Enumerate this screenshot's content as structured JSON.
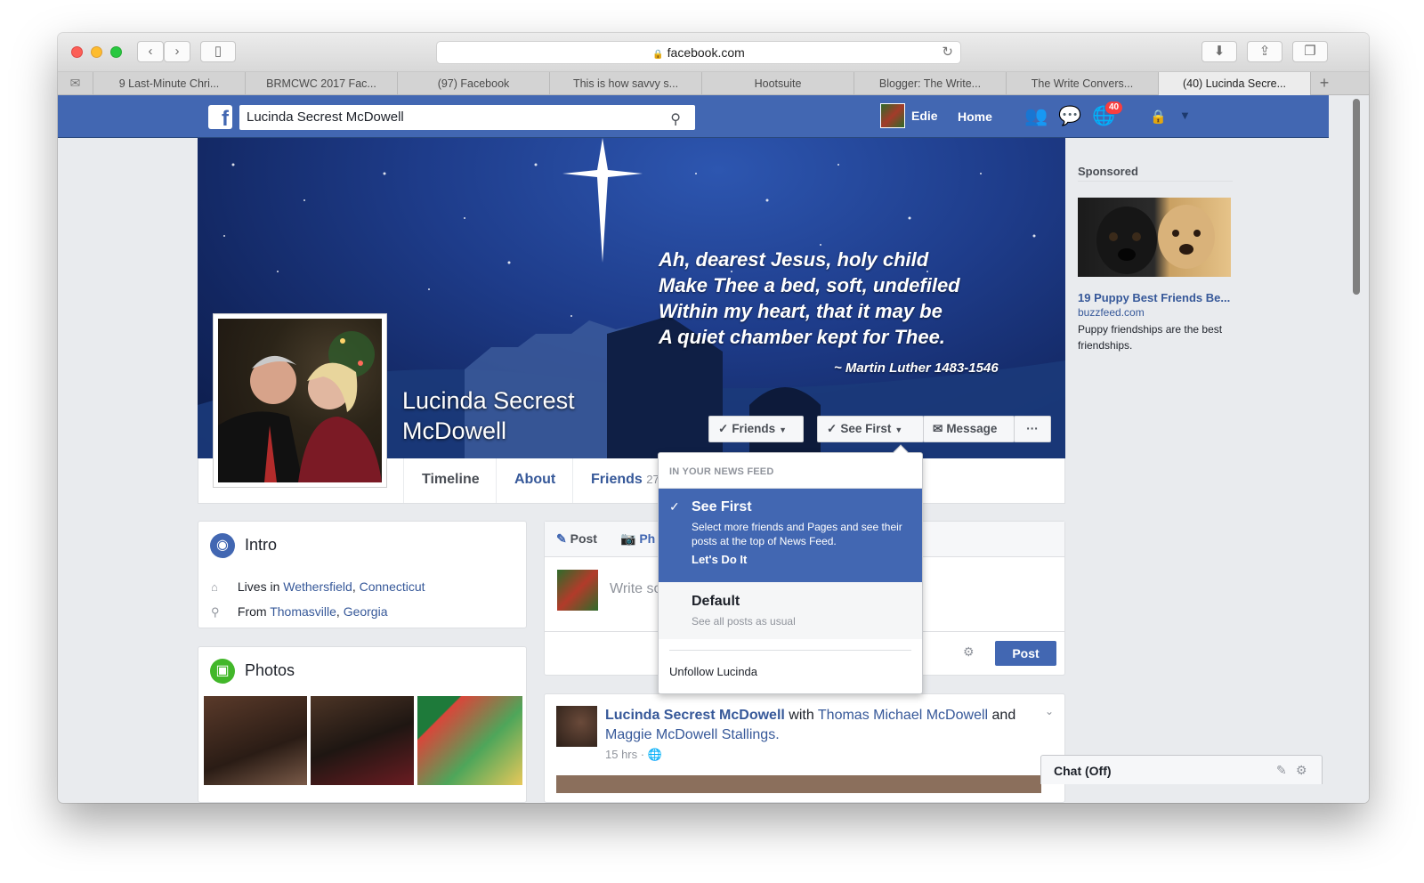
{
  "browser": {
    "url": "facebook.com",
    "tabs": [
      "9 Last-Minute Chri...",
      "BRMCWC 2017 Fac...",
      "(97) Facebook",
      "This is how savvy s...",
      "Hootsuite",
      "Blogger: The Write...",
      "The Write Convers...",
      "(40) Lucinda Secre..."
    ],
    "active_tab_index": 7
  },
  "fb_header": {
    "search_value": "Lucinda Secrest McDowell",
    "user_name": "Edie",
    "home_label": "Home",
    "notifications_count": "40",
    "colors": {
      "bar": "#4267b2",
      "badge": "#fa3e3e"
    }
  },
  "cover": {
    "quote": "Ah, dearest Jesus, holy child\nMake Thee a bed, soft, undefiled\nWithin my heart, that it may be\nA quiet chamber kept for Thee.",
    "attribution": "~ Martin Luther 1483-1546",
    "profile_name": "Lucinda Secrest McDowell",
    "buttons": {
      "friends": "Friends",
      "see_first": "See First",
      "message": "Message",
      "more": "···"
    }
  },
  "profile_nav": {
    "timeline": "Timeline",
    "about": "About",
    "friends": "Friends",
    "friends_count_partial": "27"
  },
  "intro": {
    "title": "Intro",
    "lives_prefix": "Lives in",
    "lives_city": "Wethersfield",
    "lives_state": "Connecticut",
    "from_prefix": "From",
    "from_city": "Thomasville",
    "from_state": "Georgia"
  },
  "photos": {
    "title": "Photos"
  },
  "composer": {
    "post_tab": "Post",
    "photo_tab_partial": "Ph",
    "placeholder_partial": "Write so",
    "post_button": "Post"
  },
  "feed_post": {
    "author": "Lucinda Secrest McDowell",
    "with_word": "with",
    "tagged_1": "Thomas Michael McDowell",
    "and_word": "and",
    "tagged_2": "Maggie McDowell Stallings.",
    "time": "15 hrs ·"
  },
  "dropdown": {
    "header": "IN YOUR NEWS FEED",
    "selected": {
      "title": "See First",
      "desc": "Select more friends and Pages and see their posts at the top of News Feed.",
      "cta": "Let's Do It"
    },
    "default": {
      "title": "Default",
      "desc": "See all posts as usual"
    },
    "unfollow": "Unfollow Lucinda"
  },
  "sponsored": {
    "title": "Sponsored",
    "headline": "19 Puppy Best Friends Be...",
    "domain": "buzzfeed.com",
    "description": "Puppy friendships are the best friendships."
  },
  "chat": {
    "label": "Chat (Off)"
  }
}
